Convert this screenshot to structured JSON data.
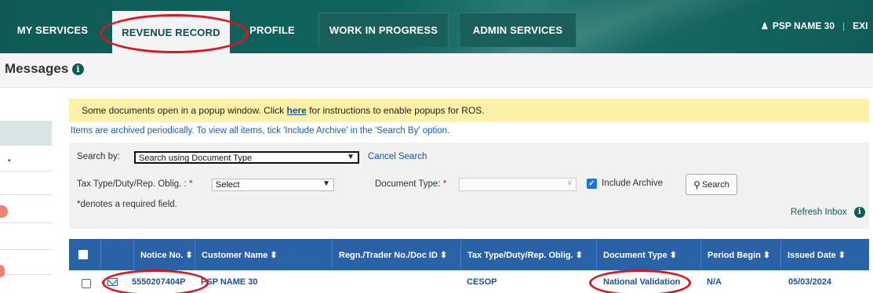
{
  "nav": {
    "tabs": [
      {
        "label": "MY SERVICES"
      },
      {
        "label": "REVENUE RECORD"
      },
      {
        "label": "PROFILE"
      },
      {
        "label": "WORK IN PROGRESS"
      },
      {
        "label": "ADMIN SERVICES"
      }
    ],
    "active_tab": "REVENUE RECORD",
    "user_name": "PSP NAME 30",
    "exit_label": "EXI"
  },
  "page": {
    "title": "Messages",
    "info_icon": "i"
  },
  "notice": {
    "prefix": "Some documents open in a popup window. Click ",
    "link": "here",
    "suffix": " for instructions to enable popups for ROS."
  },
  "archive_message": "Items are archived periodically. To view all items, tick 'Include Archive' in the 'Search By' option.",
  "search": {
    "search_by_label": "Search by:",
    "search_by_value": "Search using Document Type",
    "cancel_label": "Cancel Search",
    "tax_type_label": "Tax Type/Duty/Rep. Oblig. :",
    "tax_type_value": "Select",
    "document_type_label": "Document Type:",
    "document_type_value": "",
    "required_marker": "*",
    "include_archive_label": "Include Archive",
    "include_archive_checked": true,
    "search_button_label": "Search",
    "required_note": "*denotes a required field.",
    "refresh_label": "Refresh Inbox"
  },
  "table": {
    "columns": [
      {
        "label": "Notice No. ⬍"
      },
      {
        "label": "Customer Name ⬍"
      },
      {
        "label": "Regn./Trader No./Doc ID ⬍"
      },
      {
        "label": "Tax Type/Duty/Rep. Oblig. ⬍"
      },
      {
        "label": "Document Type ⬍"
      },
      {
        "label": "Period Begin ⬍"
      },
      {
        "label": "Issued Date ⬍"
      }
    ],
    "rows": [
      {
        "notice_no": "5550207404P",
        "customer_name": "PSP NAME 30",
        "regn": "",
        "tax_type": "CESOP",
        "document_type": "National Validation",
        "period_begin": "N/A",
        "issued_date": "05/03/2024"
      }
    ]
  },
  "colors": {
    "nav_bg": "#11655f",
    "table_header": "#2a62a8",
    "notice_bg": "#fdf1a8",
    "annotation": "#e0141e"
  }
}
